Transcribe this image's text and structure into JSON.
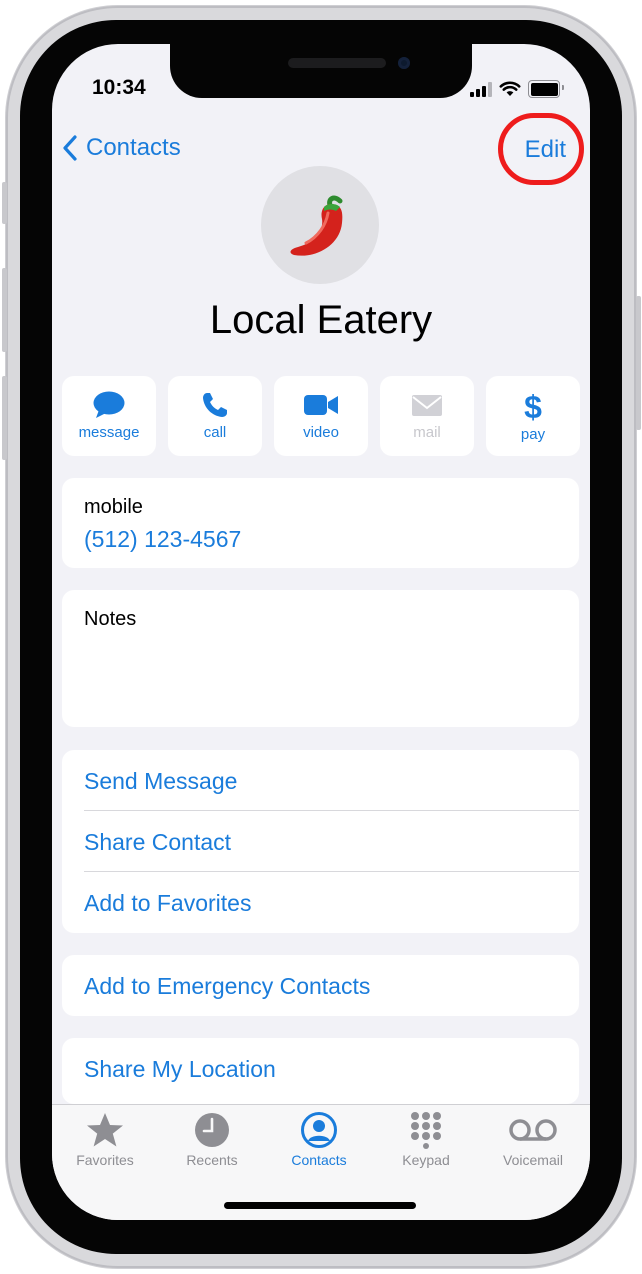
{
  "status": {
    "time": "10:34"
  },
  "nav": {
    "back_label": "Contacts",
    "edit_label": "Edit"
  },
  "contact": {
    "avatar_emoji": "🌶️",
    "name": "Local Eatery"
  },
  "actions": [
    {
      "label": "message",
      "icon": "message-bubble-icon",
      "enabled": true
    },
    {
      "label": "call",
      "icon": "phone-icon",
      "enabled": true
    },
    {
      "label": "video",
      "icon": "video-camera-icon",
      "enabled": true
    },
    {
      "label": "mail",
      "icon": "mail-envelope-icon",
      "enabled": false
    },
    {
      "label": "pay",
      "icon": "dollar-icon",
      "enabled": true
    }
  ],
  "phone": {
    "label": "mobile",
    "number": "(512) 123-4567"
  },
  "notes": {
    "label": "Notes"
  },
  "menu": {
    "send_message": "Send Message",
    "share_contact": "Share Contact",
    "add_to_favorites": "Add to Favorites",
    "add_to_emergency": "Add to Emergency Contacts",
    "share_location": "Share My Location"
  },
  "tabs": [
    {
      "label": "Favorites",
      "icon": "star-icon",
      "active": false
    },
    {
      "label": "Recents",
      "icon": "clock-icon",
      "active": false
    },
    {
      "label": "Contacts",
      "icon": "person-circle-icon",
      "active": true
    },
    {
      "label": "Keypad",
      "icon": "keypad-icon",
      "active": false
    },
    {
      "label": "Voicemail",
      "icon": "voicemail-icon",
      "active": false
    }
  ],
  "colors": {
    "accent": "#1a7cdb",
    "highlight": "#ee1c1c",
    "background": "#f2f2f7",
    "inactive": "#8e8e93"
  }
}
